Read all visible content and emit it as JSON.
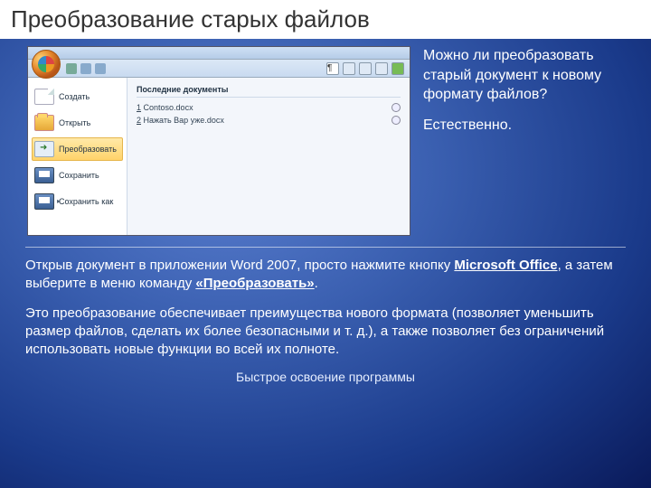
{
  "slide": {
    "title": "Преобразование старых файлов",
    "question": "Можно ли преобразовать старый документ к новому формату файлов?",
    "answer": "Естественно.",
    "para1_a": "Открыв документ в приложении Word 2007, просто нажмите кнопку ",
    "para1_b": "Microsoft Office",
    "para1_c": ", а затем выберите в меню команду ",
    "para1_d": "«Преобразовать»",
    "para1_e": ".",
    "para2": "Это преобразование обеспечивает преимущества нового формата (позволяет уменьшить размер файлов, сделать их более безопасными и т. д.), а также позволяет без ограничений использовать новые функции во всей их полноте.",
    "footer": "Быстрое освоение программы"
  },
  "office": {
    "menu": {
      "new": "Создать",
      "open": "Открыть",
      "convert": "Преобразовать",
      "save": "Сохранить",
      "saveas": "Сохранить как"
    },
    "recent": {
      "header": "Последние документы",
      "items": [
        {
          "num": "1",
          "name": "Contoso.docx"
        },
        {
          "num": "2",
          "name": "Нажать Вар уже.docx"
        }
      ]
    }
  }
}
